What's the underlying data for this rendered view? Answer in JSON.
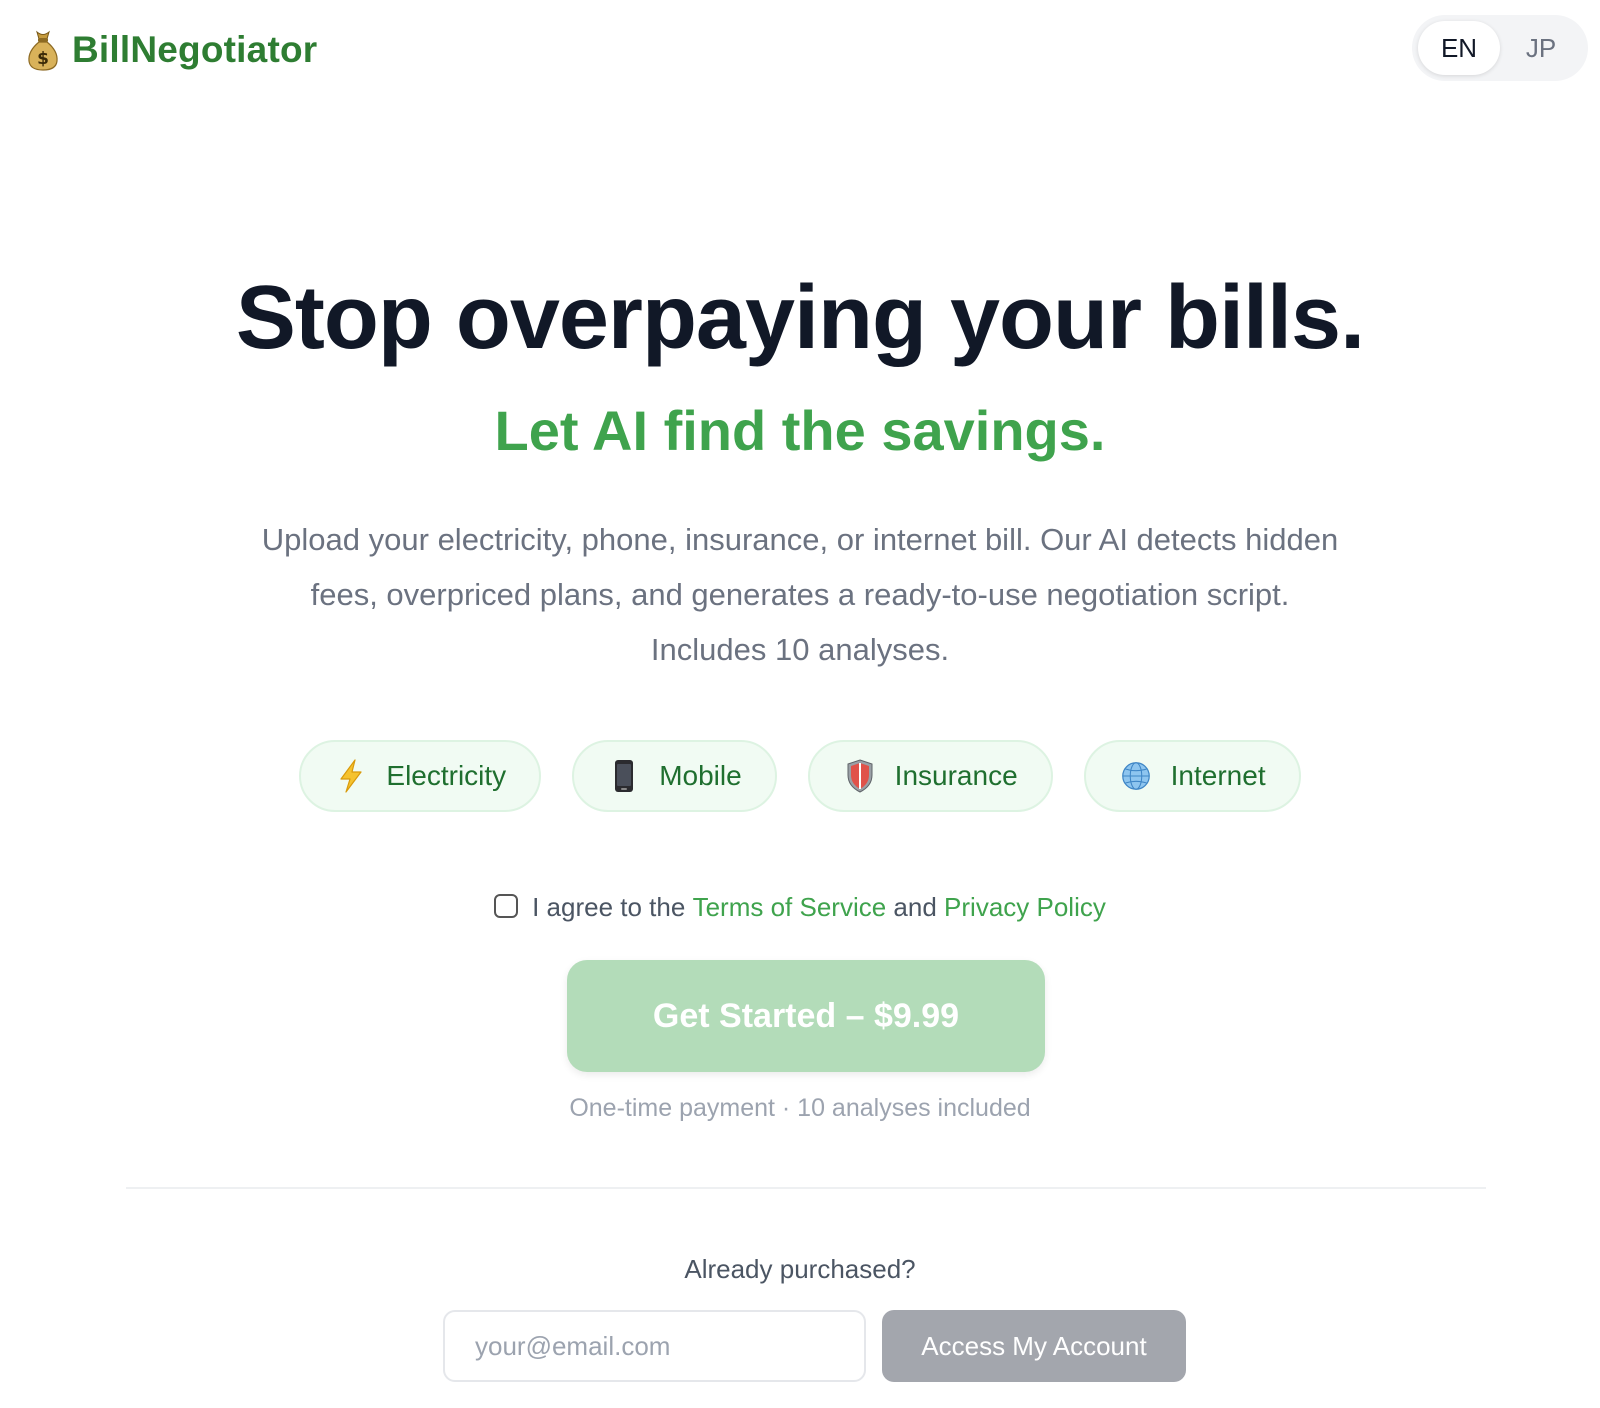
{
  "header": {
    "brand": "BillNegotiator",
    "languages": [
      {
        "label": "EN",
        "active": true
      },
      {
        "label": "JP",
        "active": false
      }
    ]
  },
  "hero": {
    "title": "Stop overpaying your bills.",
    "subtitle": "Let AI find the savings.",
    "description": "Upload your electricity, phone, insurance, or internet bill. Our AI detects hidden fees, overpriced plans, and generates a ready-to-use negotiation script. Includes 10 analyses."
  },
  "categories": [
    {
      "label": "Electricity",
      "icon": "lightning-icon"
    },
    {
      "label": "Mobile",
      "icon": "mobile-phone-icon"
    },
    {
      "label": "Insurance",
      "icon": "shield-icon"
    },
    {
      "label": "Internet",
      "icon": "globe-icon"
    }
  ],
  "terms": {
    "prefix": "I agree to the",
    "terms_link": "Terms of Service",
    "joiner": "and",
    "privacy_link": "Privacy Policy",
    "checked": false
  },
  "cta": {
    "label": "Get Started – $9.99",
    "note": "One-time payment · 10 analyses included"
  },
  "account": {
    "heading": "Already purchased?",
    "email_placeholder": "your@email.com",
    "email_value": "",
    "button_label": "Access My Account"
  },
  "colors": {
    "brand_green": "#2e7d32",
    "accent_green": "#3fa34d",
    "cta_disabled": "#b3dcb9",
    "chip_bg": "#f1fbf3",
    "heading": "#111827",
    "body_text": "#6b7280",
    "access_button": "#a3a6ad"
  }
}
